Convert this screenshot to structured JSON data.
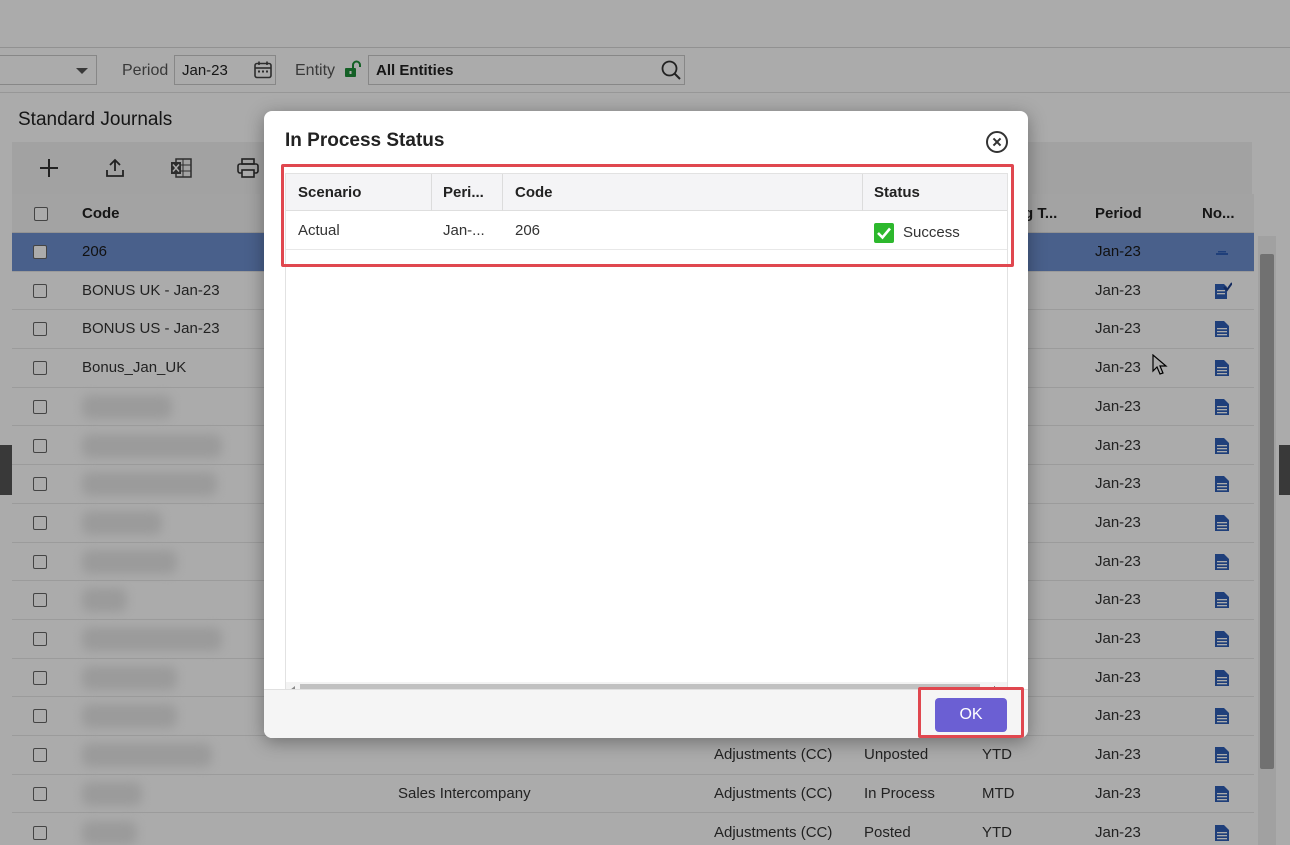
{
  "filters": {
    "period_label": "Period",
    "period_value": "Jan-23",
    "entity_label": "Entity",
    "entity_value": "All Entities"
  },
  "page": {
    "title": "Standard Journals"
  },
  "grid": {
    "columns": {
      "code": "Code",
      "entry_type": "g T...",
      "period": "Period",
      "notes": "No..."
    },
    "rows": [
      {
        "code": "206",
        "period": "Jan-23"
      },
      {
        "code": "BONUS UK - Jan-23",
        "period": "Jan-23"
      },
      {
        "code": "BONUS US - Jan-23",
        "period": "Jan-23"
      },
      {
        "code": "Bonus_Jan_UK",
        "period": "Jan-23"
      },
      {
        "code": "",
        "period": "Jan-23"
      },
      {
        "code": "",
        "period": "Jan-23"
      },
      {
        "code": "",
        "period": "Jan-23"
      },
      {
        "code": "",
        "period": "Jan-23"
      },
      {
        "code": "",
        "period": "Jan-23"
      },
      {
        "code": "",
        "period": "Jan-23"
      },
      {
        "code": "",
        "period": "Jan-23"
      },
      {
        "code": "",
        "period": "Jan-23"
      },
      {
        "code": "",
        "period": "Jan-23"
      },
      {
        "code": "",
        "description": "",
        "journal_type": "Adjustments (CC)",
        "status": "Unposted",
        "balance": "YTD",
        "period": "Jan-23"
      },
      {
        "code": "",
        "description": "Sales Intercompany",
        "journal_type": "Adjustments (CC)",
        "status": "In Process",
        "balance": "MTD",
        "period": "Jan-23"
      },
      {
        "code": "",
        "description": "",
        "journal_type": "Adjustments (CC)",
        "status": "Posted",
        "balance": "YTD",
        "period": "Jan-23"
      }
    ]
  },
  "modal": {
    "title": "In Process Status",
    "columns": {
      "scenario": "Scenario",
      "period": "Peri...",
      "code": "Code",
      "status": "Status"
    },
    "rows": [
      {
        "scenario": "Actual",
        "period": "Jan-...",
        "code": "206",
        "status": "Success"
      }
    ],
    "ok_label": "OK"
  },
  "colors": {
    "accent": "#6b5fd3",
    "highlight": "#e0474f",
    "success": "#2db82d",
    "selected_row": "#6d8fcf",
    "lock": "#1f8f3a",
    "doc_icon": "#2f5fb7"
  },
  "icons": [
    "calendar-icon",
    "lock-open-icon",
    "search-icon",
    "add-icon",
    "upload-icon",
    "excel-icon",
    "print-icon",
    "document-icon",
    "check-icon",
    "close-icon"
  ]
}
